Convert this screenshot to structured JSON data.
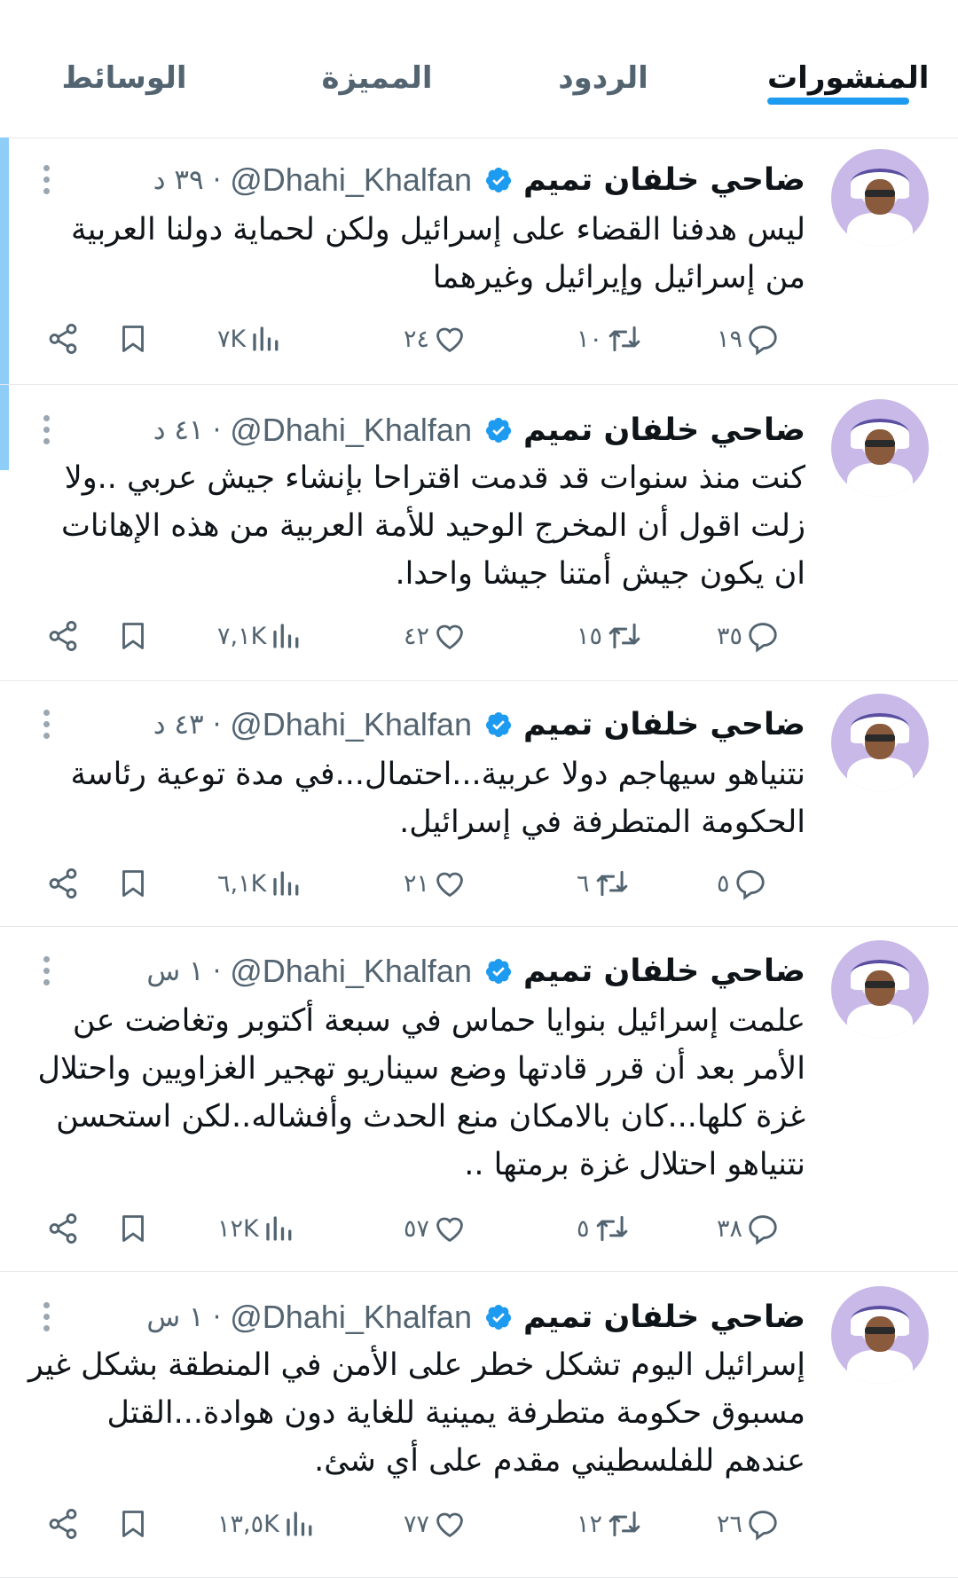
{
  "tabs": [
    {
      "label": "المنشورات",
      "active": true
    },
    {
      "label": "الردود"
    },
    {
      "label": "المميزة"
    },
    {
      "label": "الوسائط"
    }
  ],
  "colors": {
    "accent": "#1d9bf0",
    "secondary_text": "#536471"
  },
  "tweets": [
    {
      "name": "ضاحي خلفان تميم",
      "handle": "@Dhahi_Khalfan",
      "time": "٣٩ د",
      "text": "ليس هدفنا القضاء على إسرائيل  ولكن لحماية دولنا العربية من إسرائيل وإيرائيل وغيرهما",
      "replies": "١٩",
      "reposts": "١٠",
      "likes": "٢٤",
      "views": "٧K"
    },
    {
      "name": "ضاحي خلفان تميم",
      "handle": "@Dhahi_Khalfan",
      "time": "٤١ د",
      "text": "كنت منذ سنوات قد قدمت اقتراحا بإنشاء جيش عربي ..ولا زلت اقول أن المخرج الوحيد للأمة العربية من هذه الإهانات ان يكون جيش أمتنا جيشا واحدا.",
      "replies": "٣٥",
      "reposts": "١٥",
      "likes": "٤٢",
      "views": "٧,١K"
    },
    {
      "name": "ضاحي خلفان تميم",
      "handle": "@Dhahi_Khalfan",
      "time": "٤٣ د",
      "text": "نتنياهو سيهاجم دولا عربية...احتمال...في مدة توعية رئاسة الحكومة المتطرفة في إسرائيل.",
      "replies": "٥",
      "reposts": "٦",
      "likes": "٢١",
      "views": "٦,١K"
    },
    {
      "name": "ضاحي خلفان تميم",
      "handle": "@Dhahi_Khalfan",
      "time": "١ س",
      "text": "علمت إسرائيل بنوايا حماس في سبعة أكتوبر وتغاضت عن الأمر بعد أن قرر قادتها وضع سيناريو تهجير الغزاويين واحتلال غزة كلها...كان بالامكان منع الحدث وأفشاله..لكن استحسن نتنياهو احتلال غزة برمتها ..",
      "replies": "٣٨",
      "reposts": "٥",
      "likes": "٥٧",
      "views": "١٢K"
    },
    {
      "name": "ضاحي خلفان تميم",
      "handle": "@Dhahi_Khalfan",
      "time": "١ س",
      "text": "إسرائيل اليوم تشكل خطر على الأمن في المنطقة بشكل غير مسبوق حكومة متطرفة يمينية للغاية دون هوادة...القتل عندهم للفلسطيني مقدم على أي شئ.",
      "replies": "٢٦",
      "reposts": "١٢",
      "likes": "٧٧",
      "views": "١٣,٥K"
    }
  ]
}
